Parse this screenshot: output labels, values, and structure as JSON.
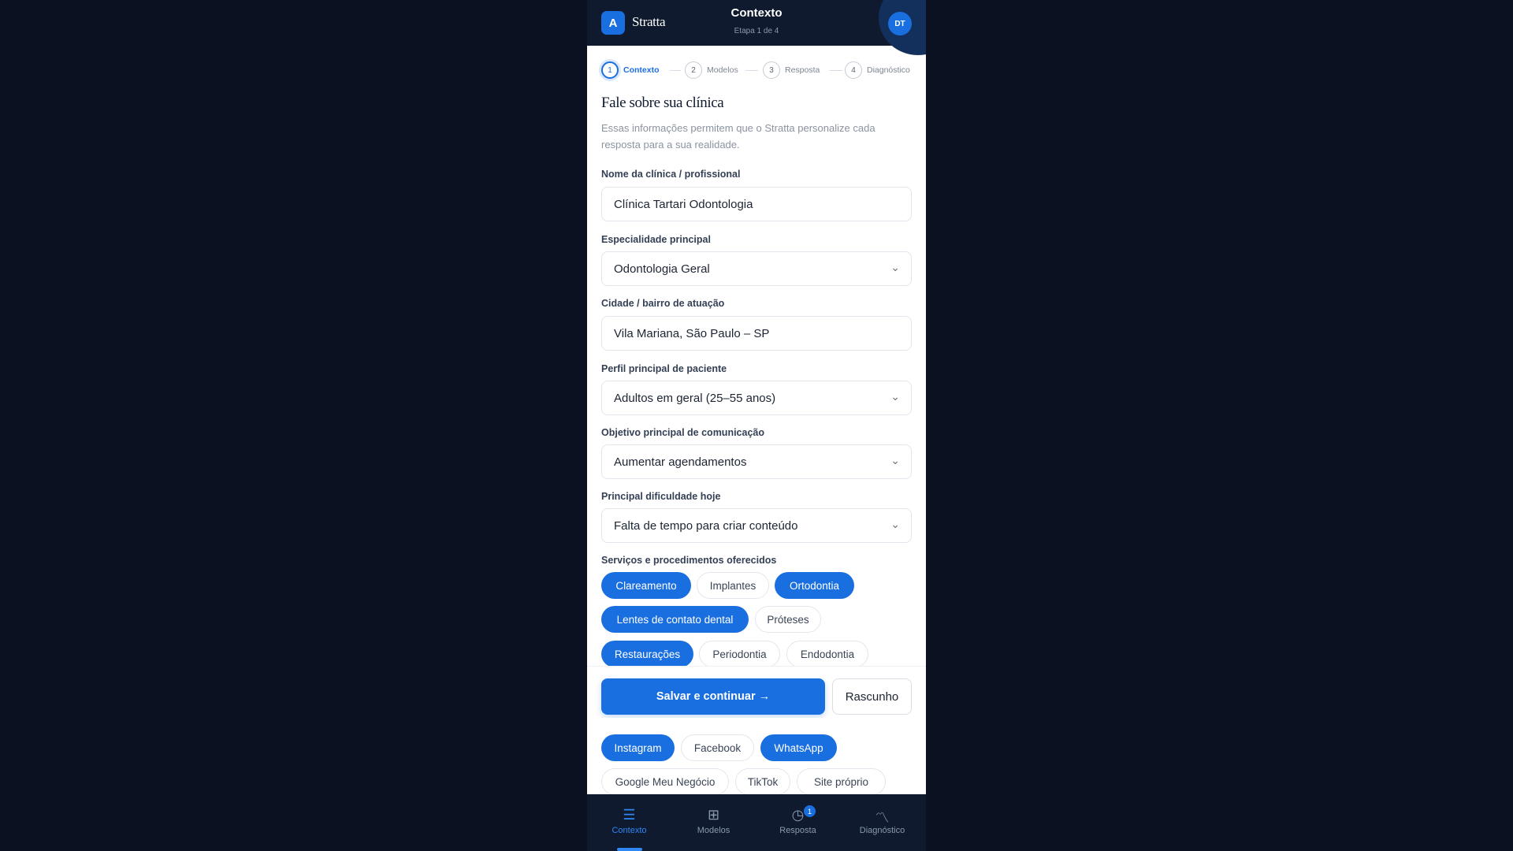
{
  "app": {
    "brand": "Stratta",
    "logo_letter": "A",
    "screen_title": "Contexto",
    "screen_subtitle": "Etapa 1 de 4",
    "avatar_initials": "DT",
    "accent": "#1a6fe0",
    "header_bg": "#0f1a2e"
  },
  "steps": [
    {
      "number": "1",
      "label": "Contexto",
      "active": true
    },
    {
      "number": "2",
      "label": "Modelos",
      "active": false
    },
    {
      "number": "3",
      "label": "Resposta",
      "active": false
    },
    {
      "number": "4",
      "label": "Diagnóstico",
      "active": false
    }
  ],
  "form": {
    "title": "Fale sobre sua clínica",
    "description": "Essas informações permitem que o Stratta personalize cada resposta para a sua realidade.",
    "fields": [
      {
        "label": "Nome da clínica / profissional",
        "value": "Clínica Tartari Odontologia",
        "type": "text"
      },
      {
        "label": "Especialidade principal",
        "value": "Odontologia Geral",
        "type": "select"
      },
      {
        "label": "Cidade / bairro de atuação",
        "value": "Vila Mariana, São Paulo – SP",
        "type": "text"
      },
      {
        "label": "Perfil principal de paciente",
        "value": "Adultos em geral (25–55 anos)",
        "type": "select"
      },
      {
        "label": "Objetivo principal de comunicação",
        "value": "Aumentar agendamentos",
        "type": "select"
      },
      {
        "label": "Principal dificuldade hoje",
        "value": "Falta de tempo para criar conteúdo",
        "type": "select"
      }
    ],
    "services_label": "Serviços e procedimentos oferecidos",
    "services": [
      {
        "label": "Clareamento",
        "selected": true
      },
      {
        "label": "Implantes",
        "selected": false
      },
      {
        "label": "Ortodontia",
        "selected": true
      },
      {
        "label": "Lentes de contato dental",
        "selected": true
      },
      {
        "label": "Próteses",
        "selected": false
      },
      {
        "label": "Restaurações",
        "selected": true
      },
      {
        "label": "Periodontia",
        "selected": false
      },
      {
        "label": "Endodontia",
        "selected": false
      }
    ],
    "channels": [
      {
        "label": "Instagram",
        "selected": true
      },
      {
        "label": "Facebook",
        "selected": false
      },
      {
        "label": "WhatsApp",
        "selected": true
      },
      {
        "label": "Google Meu Negócio",
        "selected": false
      },
      {
        "label": "TikTok",
        "selected": false
      },
      {
        "label": "Site próprio",
        "selected": false
      }
    ]
  },
  "actions": {
    "primary": "Salvar e continuar →",
    "secondary": "Rascunho"
  },
  "bottom_nav": [
    {
      "label": "Contexto",
      "icon": "menu-lines-icon",
      "active": true
    },
    {
      "label": "Modelos",
      "icon": "grid-icon",
      "active": false
    },
    {
      "label": "Resposta",
      "icon": "clock-icon",
      "active": false,
      "badge": "1"
    },
    {
      "label": "Diagnóstico",
      "icon": "trend-icon",
      "active": false
    }
  ]
}
